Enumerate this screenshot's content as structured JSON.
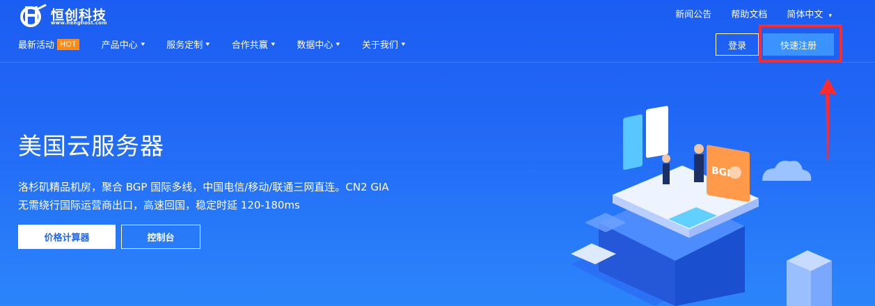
{
  "brand": {
    "name": "恒创科技",
    "domain": "www.henghost.com"
  },
  "util_nav": [
    "新闻公告",
    "帮助文档",
    "简体中文"
  ],
  "nav": [
    {
      "label": "最新活动",
      "badge": "HOT"
    },
    {
      "label": "产品中心",
      "chevron": "▾"
    },
    {
      "label": "服务定制",
      "chevron": "▾"
    },
    {
      "label": "合作共赢",
      "chevron": "▾"
    },
    {
      "label": "数据中心",
      "chevron": "▾"
    },
    {
      "label": "关于我们",
      "chevron": "▾"
    }
  ],
  "auth": {
    "login": "登录",
    "register": "快速注册"
  },
  "hero": {
    "title": "美国云服务器",
    "line1": "洛杉矶精品机房，聚合 BGP 国际多线，中国电信/移动/联通三网直连。CN2 GIA",
    "line2": "无需绕行国际运营商出口，高速回国，稳定时延 120-180ms",
    "btn_price": "价格计算器",
    "btn_console": "控制台"
  },
  "illustration": {
    "badge": "BGP"
  },
  "colors": {
    "bg_top": "#1b5df2",
    "bg_bottom": "#2c85fb",
    "hot": "#ff8a14",
    "register_bg": "#3a93ff",
    "highlight": "#ff2a2a"
  }
}
